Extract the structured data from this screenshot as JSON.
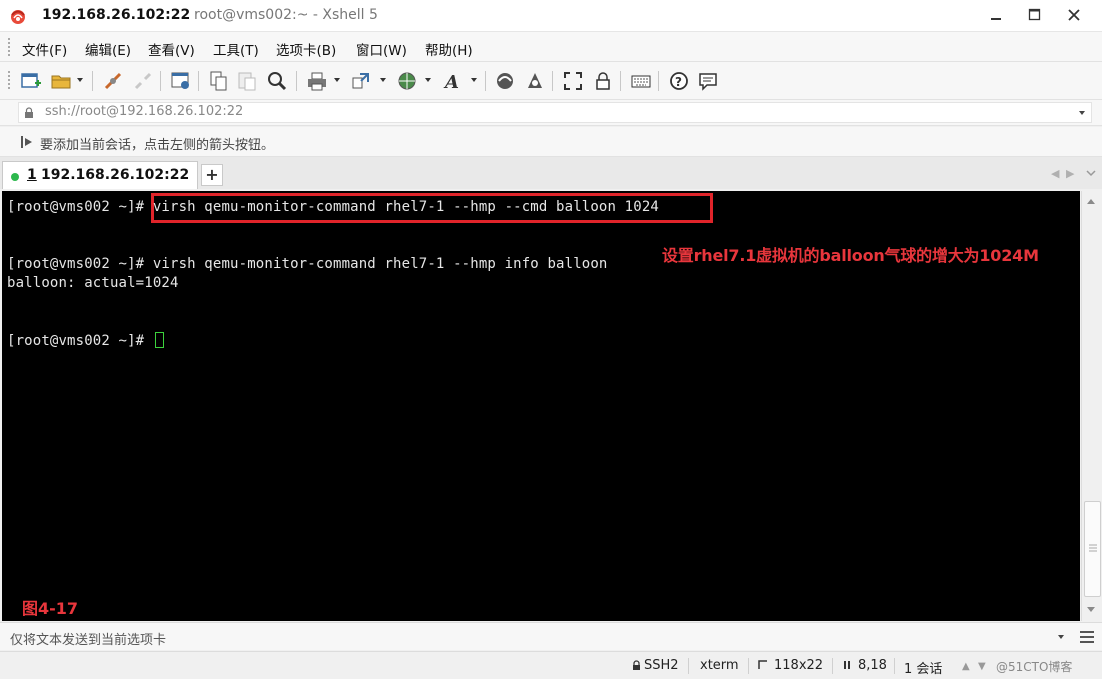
{
  "window": {
    "host": "192.168.26.102:22",
    "subtitle": "root@vms002:~ - Xshell 5"
  },
  "menu": [
    "文件(F)",
    "编辑(E)",
    "查看(V)",
    "工具(T)",
    "选项卡(B)",
    "窗口(W)",
    "帮助(H)"
  ],
  "address": {
    "value": "ssh://root@192.168.26.102:22"
  },
  "hint": {
    "text": "要添加当前会话，点击左侧的箭头按钮。"
  },
  "tab": {
    "number": "1",
    "label": " 192.168.26.102:22"
  },
  "terminal": {
    "lines": [
      "[root@vms002 ~]# virsh qemu-monitor-command rhel7-1 --hmp --cmd balloon 1024",
      "[root@vms002 ~]# virsh qemu-monitor-command rhel7-1 --hmp info balloon",
      "balloon: actual=1024",
      "[root@vms002 ~]# "
    ],
    "annotation": "设置rhel7.1虚拟机的balloon气球的增大为1024M",
    "figure_label": "图4-17"
  },
  "compose": {
    "placeholder": "仅将文本发送到当前选项卡"
  },
  "status": {
    "protocol": "SSH2",
    "terminal_type": "xterm",
    "size": "118x22",
    "cursor_pos": "8,18",
    "sessions": "1 会话",
    "watermark": "@51CTO博客"
  },
  "colors": {
    "annotation_red": "#e8363c",
    "active_dot": "#2db84d",
    "cursor_green": "#3cd23c"
  }
}
